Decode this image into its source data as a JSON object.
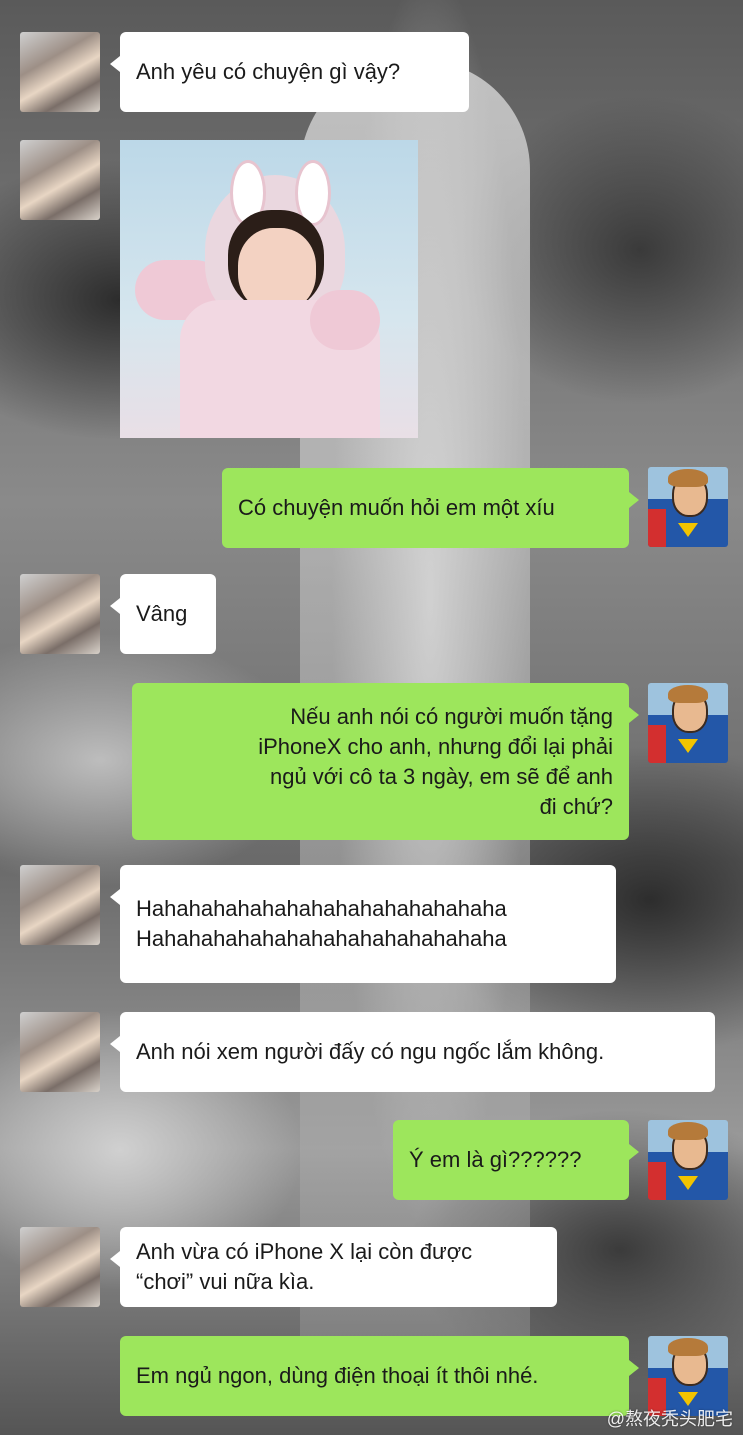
{
  "messages": [
    {
      "from": "her",
      "text": "Anh yêu có chuyện gì vậy?"
    },
    {
      "from": "her",
      "type": "image",
      "image_icon": "sticker-girl-bunny-hood"
    },
    {
      "from": "me",
      "text": "Có chuyện muốn hỏi em một xíu"
    },
    {
      "from": "her",
      "text": "Vâng"
    },
    {
      "from": "me",
      "lines": [
        "Nếu anh nói có người muốn tặng",
        "iPhoneX cho anh, nhưng đổi lại phải",
        "ngủ với cô ta 3 ngày, em sẽ để anh",
        "đi chứ?"
      ]
    },
    {
      "from": "her",
      "lines": [
        "Hahahahahahahahahahahahahahaha",
        "Hahahahahahahahahahahahahahaha"
      ]
    },
    {
      "from": "her",
      "text": "Anh nói xem người đấy có ngu ngốc lắm không."
    },
    {
      "from": "me",
      "text": "Ý em là gì??????"
    },
    {
      "from": "her",
      "lines": [
        "Anh vừa có iPhone X lại còn được",
        "“chơi” vui nữa kìa."
      ]
    },
    {
      "from": "me",
      "text": "Em ngủ ngon, dùng điện thoại ít thôi nhé."
    }
  ],
  "watermark": "@熬夜秃头肥宅",
  "colors": {
    "my_bubble": "#9de65c",
    "her_bubble": "#ffffff"
  }
}
